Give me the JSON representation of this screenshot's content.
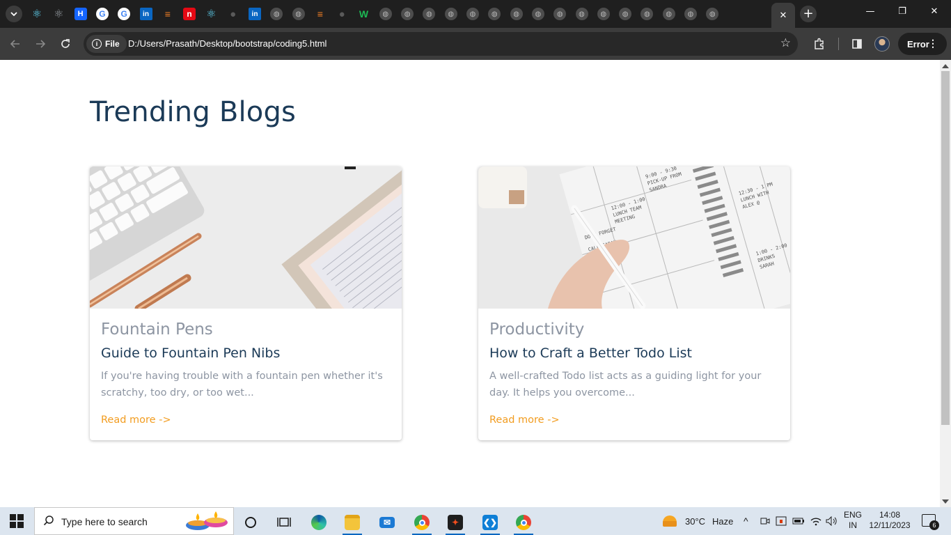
{
  "browser": {
    "tabs": [
      {
        "icon": "react-icon",
        "glyph": "⚛"
      },
      {
        "icon": "react-gray-icon",
        "glyph": "⚛"
      },
      {
        "icon": "hook-icon",
        "glyph": "H"
      },
      {
        "icon": "google-icon",
        "glyph": "G"
      },
      {
        "icon": "google-icon",
        "glyph": "G"
      },
      {
        "icon": "linkedin-icon",
        "glyph": "in"
      },
      {
        "icon": "stackoverflow-icon",
        "glyph": "≡"
      },
      {
        "icon": "n-icon",
        "glyph": "n"
      },
      {
        "icon": "react-icon",
        "glyph": "⚛"
      },
      {
        "icon": "github-icon",
        "glyph": "●"
      },
      {
        "icon": "linkedin-icon",
        "glyph": "in"
      },
      {
        "icon": "globe-icon",
        "glyph": "◍"
      },
      {
        "icon": "globe-icon",
        "glyph": "◍"
      },
      {
        "icon": "stackoverflow-icon",
        "glyph": "≡"
      },
      {
        "icon": "github-icon",
        "glyph": "●"
      },
      {
        "icon": "w-icon",
        "glyph": "W"
      },
      {
        "icon": "globe-icon",
        "glyph": "◍"
      },
      {
        "icon": "globe-icon",
        "glyph": "◍"
      },
      {
        "icon": "globe-icon",
        "glyph": "◍"
      },
      {
        "icon": "globe-icon",
        "glyph": "◍"
      },
      {
        "icon": "globe-icon",
        "glyph": "◍"
      },
      {
        "icon": "globe-icon",
        "glyph": "◍"
      },
      {
        "icon": "globe-icon",
        "glyph": "◍"
      },
      {
        "icon": "globe-icon",
        "glyph": "◍"
      },
      {
        "icon": "globe-icon",
        "glyph": "◍"
      },
      {
        "icon": "globe-icon",
        "glyph": "◍"
      },
      {
        "icon": "globe-icon",
        "glyph": "◍"
      },
      {
        "icon": "globe-icon",
        "glyph": "◍"
      },
      {
        "icon": "globe-icon",
        "glyph": "◍"
      },
      {
        "icon": "globe-icon",
        "glyph": "◍"
      },
      {
        "icon": "globe-icon",
        "glyph": "◍"
      },
      {
        "icon": "globe-icon",
        "glyph": "◍"
      }
    ],
    "active_tab_close": "✕",
    "new_tab": "+",
    "window_controls": {
      "minimize": "—",
      "restore": "❐",
      "close": "✕"
    },
    "site_chip": "File",
    "url": "D:/Users/Prasath/Desktop/bootstrap/coding5.html",
    "profile_error": "Error"
  },
  "page": {
    "title": "Trending Blogs",
    "cards": [
      {
        "category": "Fountain Pens",
        "heading": "Guide to Fountain Pen Nibs",
        "description": "If you're having trouble with a fountain pen whether it's scratchy, too dry, or too wet...",
        "link": "Read more ->"
      },
      {
        "category": "Productivity",
        "heading": "How to Craft a Better Todo List",
        "description": "A well-crafted Todo list acts as a guiding light for your day. It helps you overcome...",
        "link": "Read more ->"
      }
    ],
    "colors": {
      "title": "#1b3a57",
      "muted": "#8d95a2",
      "link": "#f29c1f"
    }
  },
  "taskbar": {
    "search_placeholder": "Type here to search",
    "weather_temp": "30°C",
    "weather_desc": "Haze",
    "lang_line1": "ENG",
    "lang_line2": "IN",
    "time": "14:08",
    "date": "12/11/2023",
    "notification_count": "6"
  }
}
